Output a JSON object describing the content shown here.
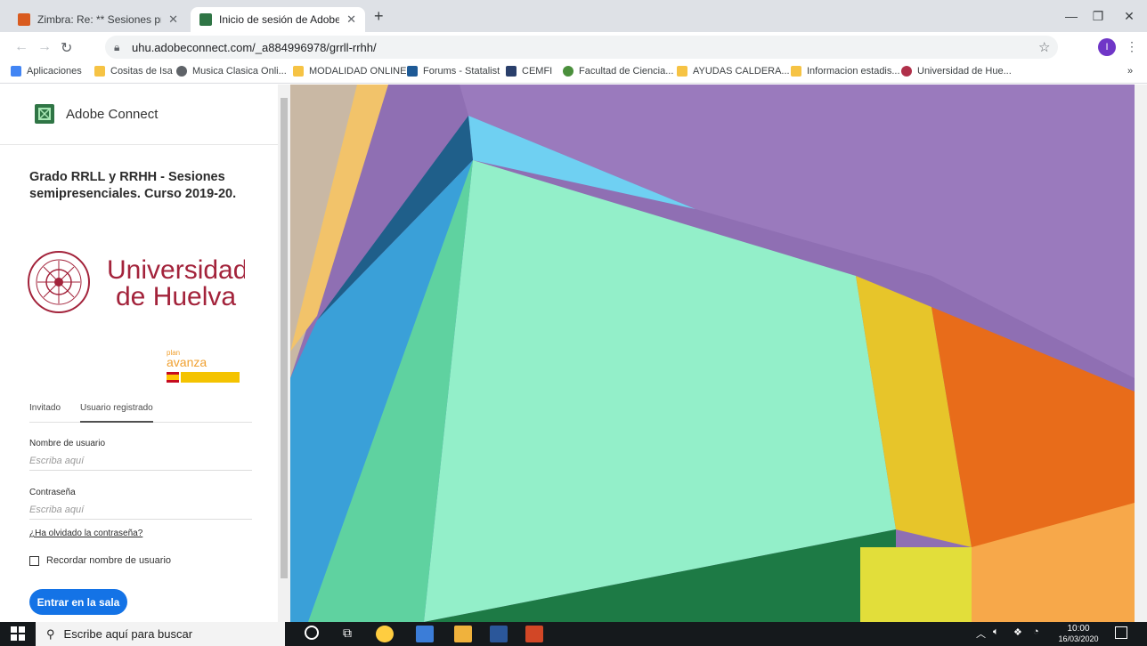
{
  "browser": {
    "tabs": [
      {
        "title": "Zimbra: Re: ** Sesiones presencia",
        "active": false,
        "favicon_color": "#d95b1f"
      },
      {
        "title": "Inicio de sesión de Adobe Conne",
        "active": true,
        "favicon_color": "#2f7545"
      }
    ],
    "new_tab_label": "+",
    "url": "uhu.adobeconnect.com/_a884996978/grrll-rrhh/",
    "profile_initial": "I",
    "bookmarks": [
      {
        "label": "Aplicaciones",
        "color": "#4285f4"
      },
      {
        "label": "Cositas de Isa",
        "color": "#f6c344"
      },
      {
        "label": "Musica Clasica Onli...",
        "color": "#5f6368"
      },
      {
        "label": "MODALIDAD ONLINE",
        "color": "#f6c344"
      },
      {
        "label": "Forums - Statalist",
        "color": "#1e5a96"
      },
      {
        "label": "CEMFI",
        "color": "#2a3f6b"
      },
      {
        "label": "Facultad de Ciencia...",
        "color": "#4a8f3c"
      },
      {
        "label": "AYUDAS CALDERA...",
        "color": "#f6c344"
      },
      {
        "label": "Informacion estadis...",
        "color": "#f6c344"
      },
      {
        "label": "Universidad de Hue...",
        "color": "#b0304a"
      }
    ],
    "more_bookmarks": "»"
  },
  "login": {
    "app_name": "Adobe Connect",
    "meeting_title": "Grado RRLL y RRHH - Sesiones semipresenciales. Curso 2019-20.",
    "university_line1": "Universidad",
    "university_line2": "de Huelva",
    "plan_small": "plan",
    "plan_big": "avanza",
    "tabs": {
      "guest": "Invitado",
      "registered": "Usuario registrado"
    },
    "username_label": "Nombre de usuario",
    "username_placeholder": "Escriba aquí",
    "password_label": "Contraseña",
    "password_placeholder": "Escriba aquí",
    "forgot_link": "¿Ha olvidado la contraseña?",
    "remember_label": "Recordar nombre de usuario",
    "enter_button": "Entrar en la sala"
  },
  "taskbar": {
    "search_placeholder": "Escribe aquí para buscar",
    "time": "10:00",
    "date": "16/03/2020"
  }
}
